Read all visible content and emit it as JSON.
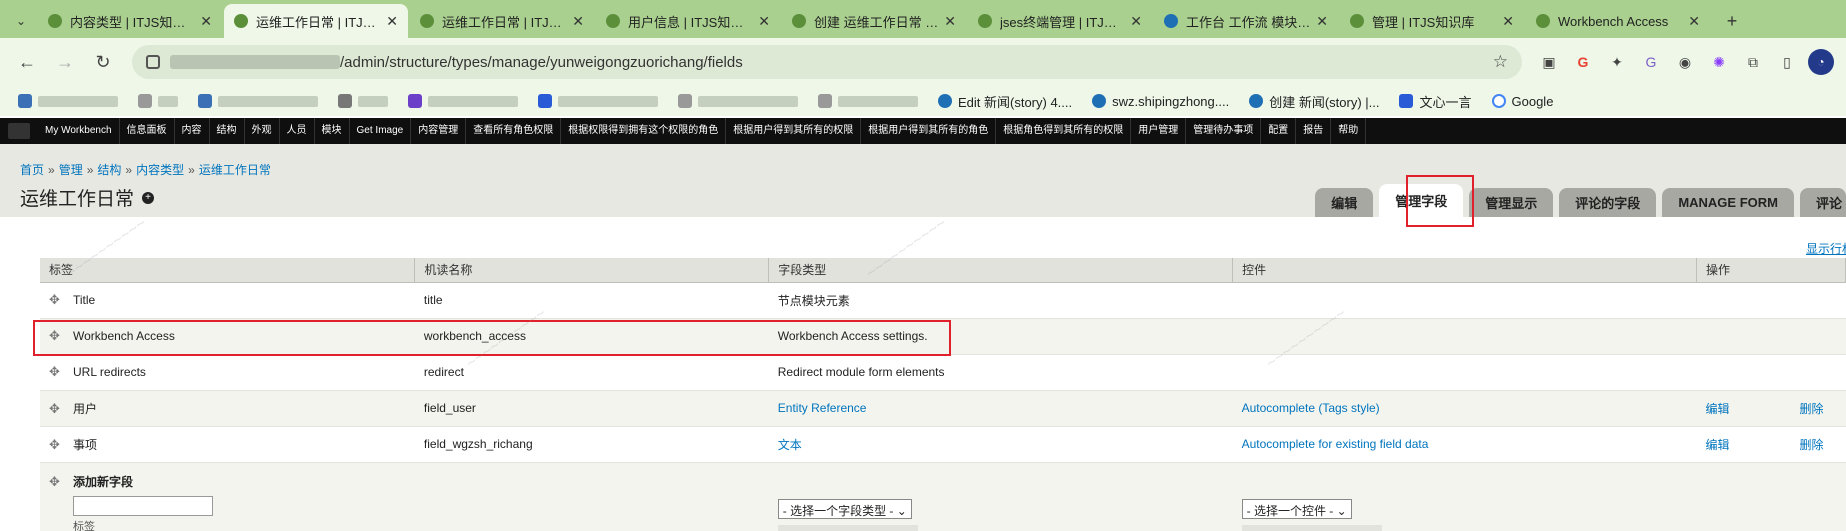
{
  "tabs": [
    {
      "title": "内容类型 | ITJS知识库",
      "active": false
    },
    {
      "title": "运维工作日常 | ITJS知识库",
      "active": true
    },
    {
      "title": "运维工作日常 | ITJS知识库",
      "active": false
    },
    {
      "title": "用户信息 | ITJS知识库",
      "active": false
    },
    {
      "title": "创建 运维工作日常 | ITJS",
      "active": false
    },
    {
      "title": "jses终端管理 | ITJS知识库",
      "active": false
    },
    {
      "title": "工作台 工作流 模块 ITJS",
      "active": false
    },
    {
      "title": "管理 | ITJS知识库",
      "active": false
    },
    {
      "title": "Workbench Access",
      "active": false
    }
  ],
  "address": {
    "url_visible": "/admin/structure/types/manage/yunweigongzuorichang/fields"
  },
  "bookmarks": [
    {
      "label": "Edit 新闻(story) 4...."
    },
    {
      "label": "swz.shipingzhong...."
    },
    {
      "label": "创建 新闻(story) |..."
    },
    {
      "label": "文心一言"
    },
    {
      "label": "Google"
    }
  ],
  "admin_toolbar": [
    "My Workbench",
    "信息面板",
    "内容",
    "结构",
    "外观",
    "人员",
    "模块",
    "Get Image",
    "内容管理",
    "查看所有角色权限",
    "根据权限得到拥有这个权限的角色",
    "根据用户得到其所有的权限",
    "根据用户得到其所有的角色",
    "根据角色得到其所有的权限",
    "用户管理",
    "管理待办事项",
    "配置",
    "报告",
    "帮助"
  ],
  "breadcrumb": [
    "首页",
    "管理",
    "结构",
    "内容类型",
    "运维工作日常"
  ],
  "page_title": "运维工作日常",
  "primary_tabs": [
    "编辑",
    "管理字段",
    "管理显示",
    "评论的字段",
    "MANAGE FORM",
    "评论"
  ],
  "active_tab_index": 1,
  "show_weights": "显示行权重",
  "table": {
    "headers": [
      "标签",
      "机读名称",
      "字段类型",
      "控件",
      "操作"
    ],
    "rows": [
      {
        "label": "Title",
        "machine": "title",
        "type": "节点模块元素",
        "widget": "",
        "edit": "",
        "delete": ""
      },
      {
        "label": "Workbench Access",
        "machine": "workbench_access",
        "type": "Workbench Access settings.",
        "widget": "",
        "edit": "",
        "delete": ""
      },
      {
        "label": "URL redirects",
        "machine": "redirect",
        "type": "Redirect module form elements",
        "widget": "",
        "edit": "",
        "delete": ""
      },
      {
        "label": "用户",
        "machine": "field_user",
        "type": "Entity Reference",
        "widget": "Autocomplete (Tags style)",
        "edit": "编辑",
        "delete": "删除"
      },
      {
        "label": "事项",
        "machine": "field_wgzsh_richang",
        "type": "文本",
        "widget": "Autocomplete for existing field data",
        "edit": "编辑",
        "delete": "删除"
      }
    ],
    "add_new": {
      "label": "添加新字段",
      "input_sub": "标签",
      "type_select": "- 选择一个字段类型 -",
      "widget_select": "- 选择一个控件 -"
    }
  },
  "colors": {
    "accent_link": "#0074bd",
    "highlight": "#e0202a",
    "tabstrip": "#a9d08e"
  }
}
